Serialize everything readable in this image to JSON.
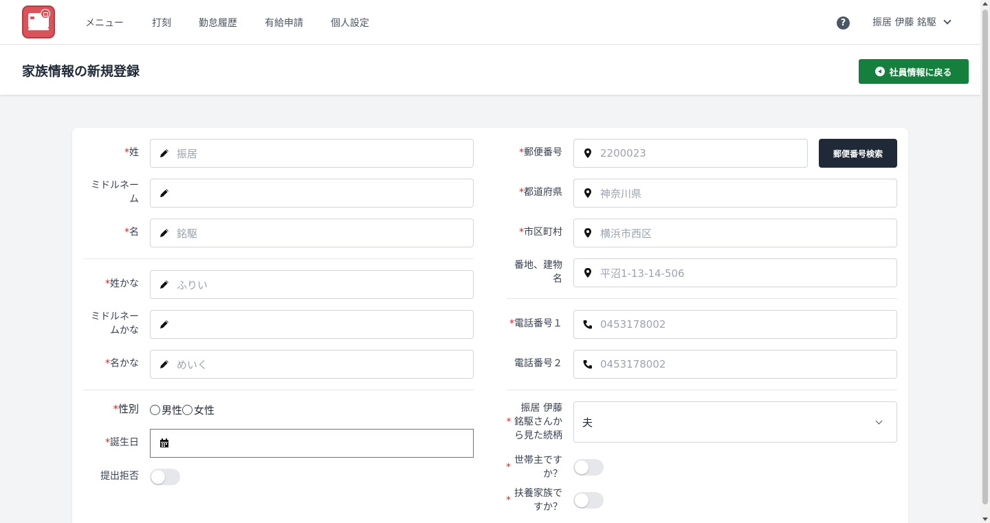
{
  "nav": {
    "links": [
      "メニュー",
      "打刻",
      "勤怠履歴",
      "有給申請",
      "個人設定"
    ],
    "help": "?",
    "user": "振居 伊藤 銘駆"
  },
  "header": {
    "title": "家族情報の新規登録",
    "back_label": "社員情報に戻る"
  },
  "form": {
    "required_mark": "*",
    "left": {
      "last_name": {
        "label": "姓",
        "placeholder": "振居"
      },
      "middle_name": {
        "label_1": "ミドルネー",
        "label_2": "ム",
        "placeholder": ""
      },
      "first_name": {
        "label": "名",
        "placeholder": "銘駆"
      },
      "last_name_kana": {
        "label": "姓かな",
        "placeholder": "ふりい"
      },
      "middle_name_kana": {
        "label_1": "ミドルネー",
        "label_2": "ムかな",
        "placeholder": ""
      },
      "first_name_kana": {
        "label": "名かな",
        "placeholder": "めいく"
      },
      "gender": {
        "label": "性別",
        "options": [
          "男性",
          "女性"
        ]
      },
      "birthday": {
        "label": "誕生日"
      },
      "refuse": {
        "label": "提出拒否"
      }
    },
    "right": {
      "postal": {
        "label": "郵便番号",
        "placeholder": "2200023",
        "search_label": "郵便番号検索"
      },
      "prefecture": {
        "label": "都道府県",
        "placeholder": "神奈川県"
      },
      "city": {
        "label": "市区町村",
        "placeholder": "横浜市西区"
      },
      "address": {
        "label_1": "番地、建物",
        "label_2": "名",
        "placeholder": "平沼1-13-14-506"
      },
      "phone1": {
        "label": "電話番号１",
        "placeholder": "0453178002"
      },
      "phone2": {
        "label": "電話番号２",
        "placeholder": "0453178002"
      },
      "relation": {
        "label_1": "振居 伊藤",
        "label_2": "銘駆さんか",
        "label_3": "ら見た続柄",
        "value": "夫"
      },
      "household_head": {
        "label_1": "世帯主です",
        "label_2": "か？"
      },
      "dependent": {
        "label_1": "扶養家族で",
        "label_2": "すか？"
      }
    }
  }
}
